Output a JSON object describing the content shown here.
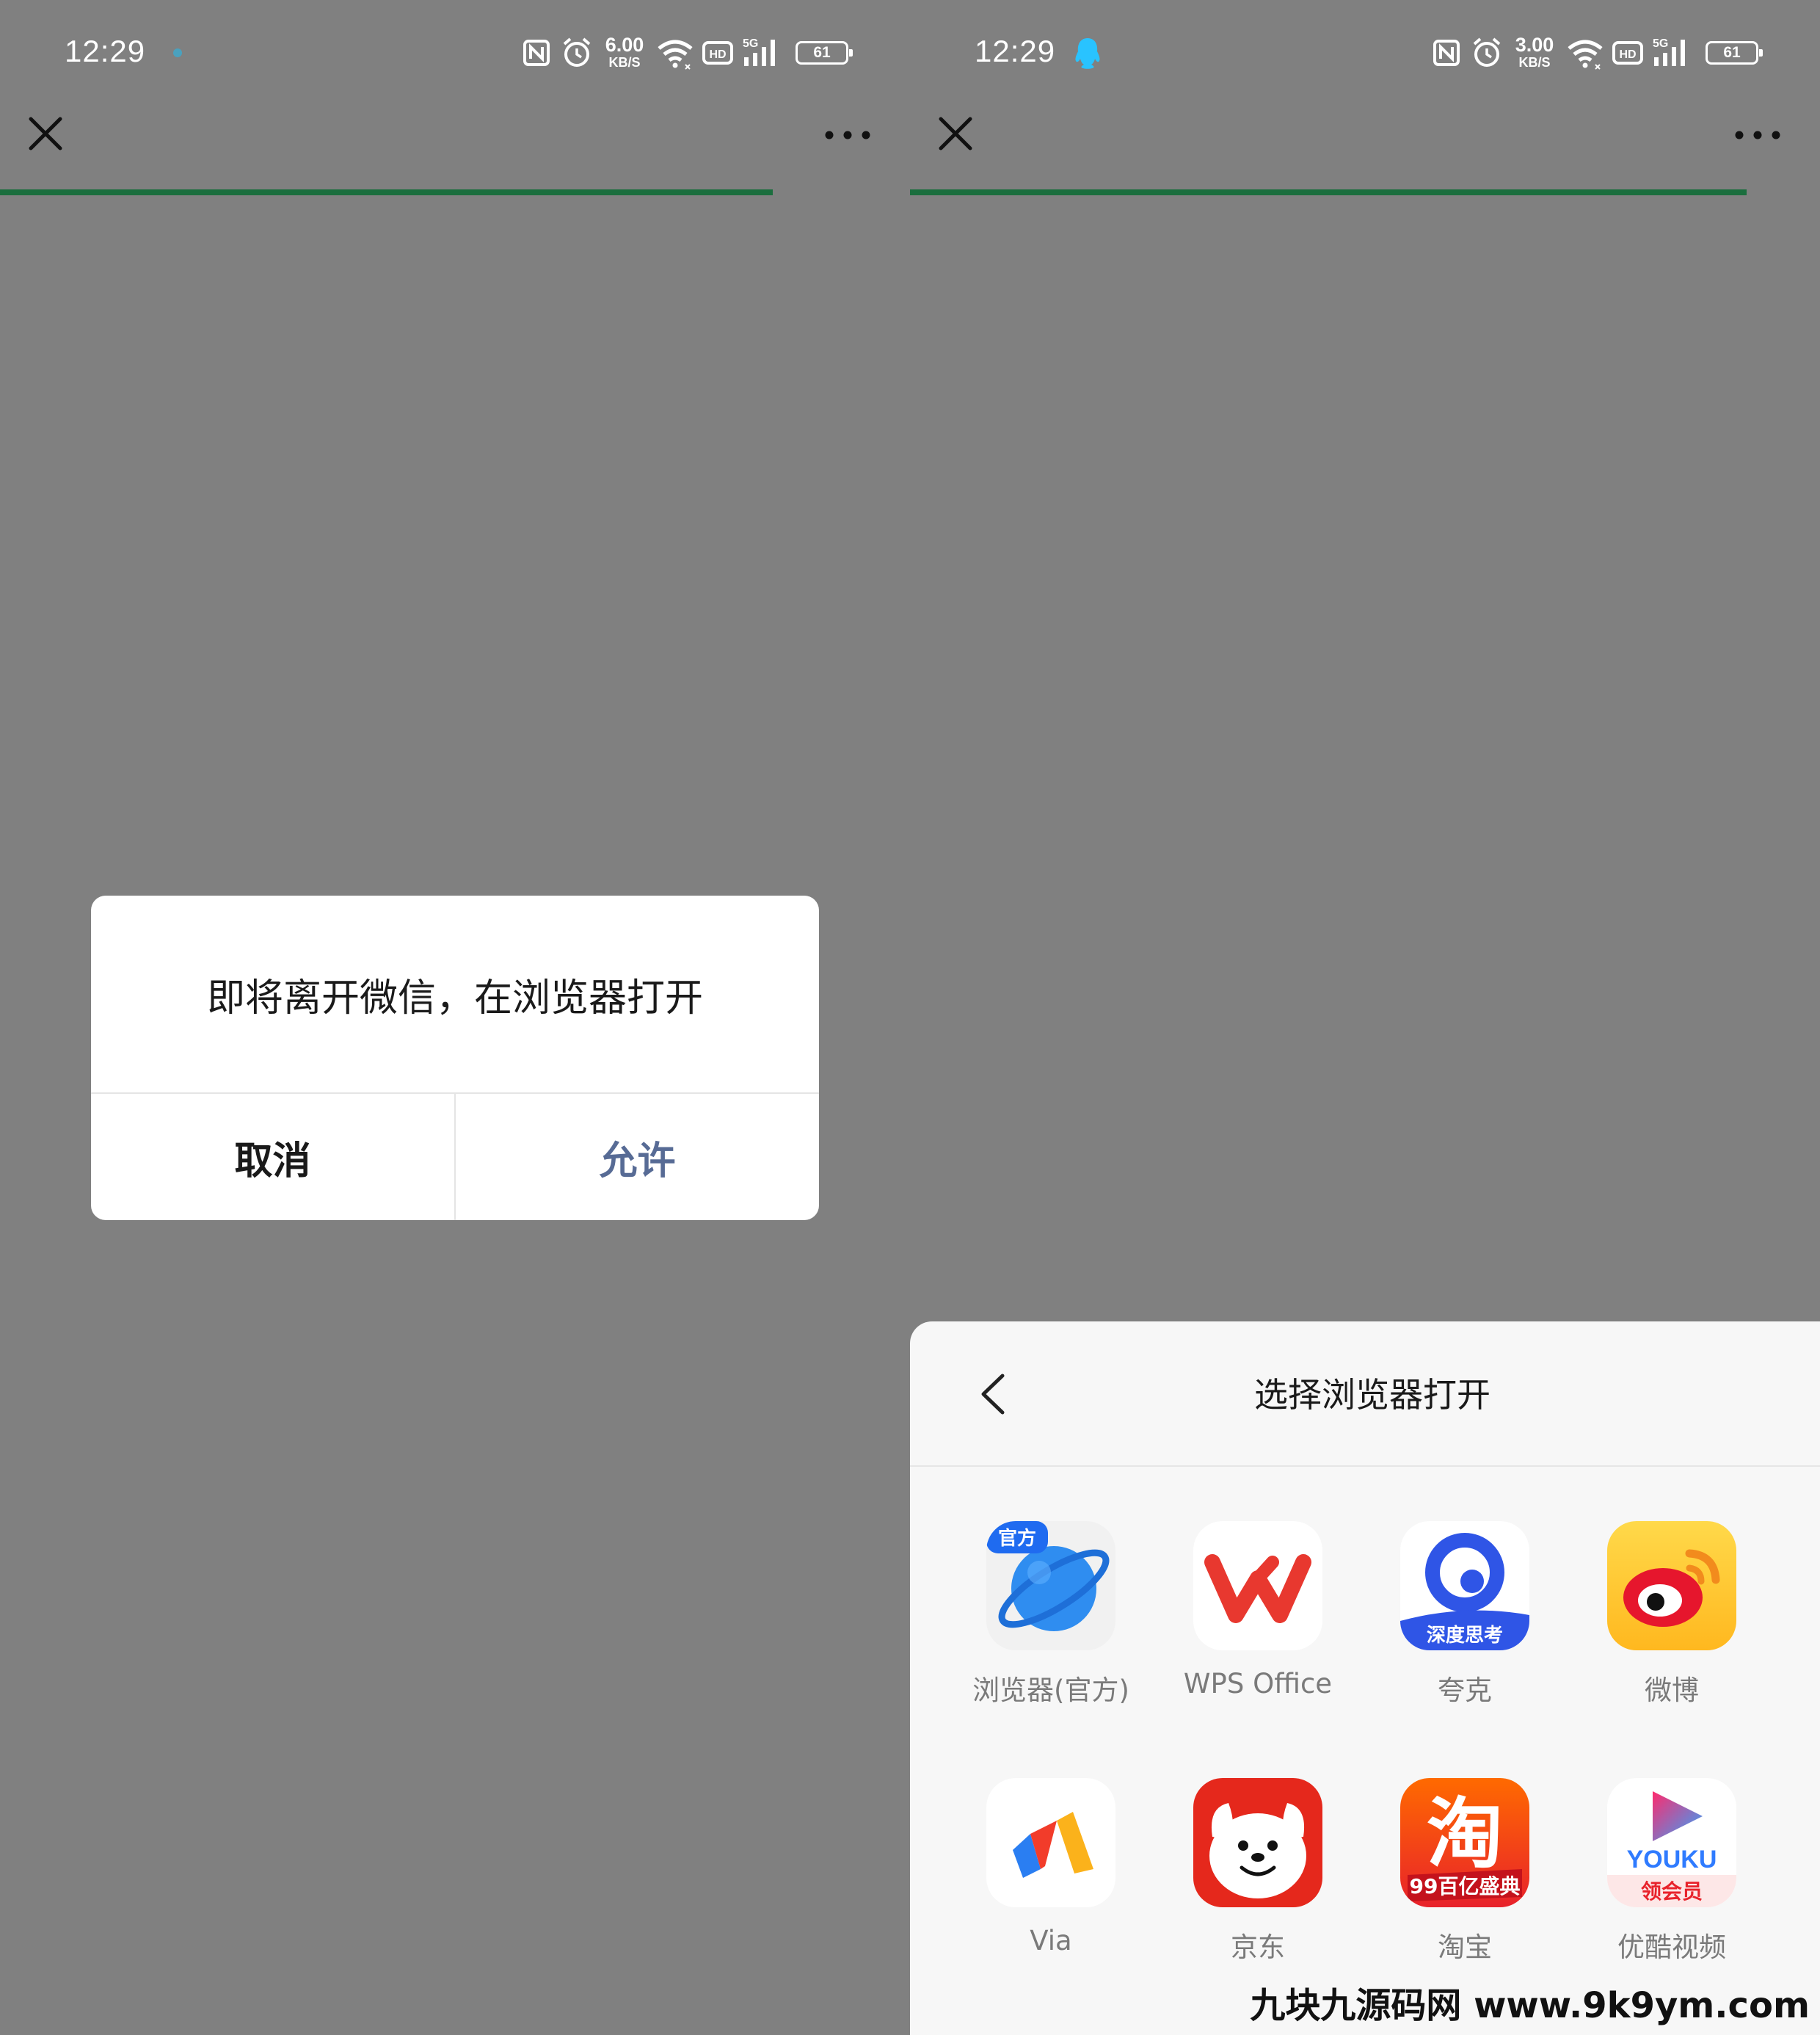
{
  "left_screen": {
    "status": {
      "time": "12:29",
      "speed_value": "6.00",
      "speed_unit": "KB/S",
      "network": "5G",
      "battery": "61"
    },
    "dialog": {
      "message": "即将离开微信，在浏览器打开",
      "cancel_label": "取消",
      "allow_label": "允许"
    }
  },
  "right_screen": {
    "status": {
      "time": "12:29",
      "speed_value": "3.00",
      "speed_unit": "KB/S",
      "network": "5G",
      "battery": "61"
    },
    "sheet": {
      "title": "选择浏览器打开",
      "apps": [
        {
          "label": "浏览器(官方)",
          "badge": "官方",
          "icon": "browser-planet-icon"
        },
        {
          "label": "WPS Office",
          "icon": "wps-icon"
        },
        {
          "label": "夸克",
          "badge": "深度思考",
          "icon": "quark-icon"
        },
        {
          "label": "微博",
          "icon": "weibo-icon"
        },
        {
          "label": "Via",
          "icon": "via-icon"
        },
        {
          "label": "京东",
          "icon": "jd-dog-icon"
        },
        {
          "label": "淘宝",
          "badge": "99百亿盛典",
          "icon": "taobao-icon"
        },
        {
          "label": "优酷视频",
          "badge": "领会员",
          "brand": "YOUKU",
          "icon": "youku-icon"
        }
      ]
    }
  },
  "watermark": "九块九源码网 www.9k9ym.com",
  "colors": {
    "overlay": "#808080",
    "progress": "#1b6e3e",
    "allow_text": "#576b95",
    "wps_red": "#e8382f",
    "quark_blue": "#2f55e6",
    "jd_red": "#e5281c",
    "taobao_orange": "#ff4a00"
  }
}
